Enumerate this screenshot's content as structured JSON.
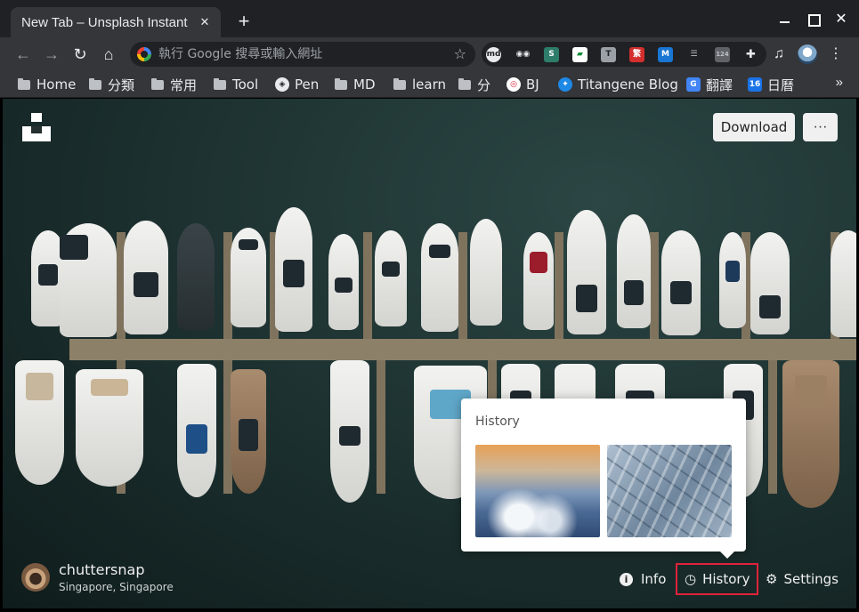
{
  "browser": {
    "tab_title": "New Tab – Unsplash Instant",
    "tab_close": "✕",
    "new_tab": "+",
    "omnibox_placeholder": "執行 Google 搜尋或輸入網址",
    "bookmarks": [
      "Home",
      "分類",
      "常用",
      "Tool",
      "Pen",
      "MD",
      "learn",
      "分",
      "BJ",
      "Titangene Blog",
      "翻譯",
      "日曆"
    ],
    "bookmarks_more": "»"
  },
  "page": {
    "download_label": "Download",
    "more_label": "···",
    "history_popup_title": "History",
    "photographer_name": "chuttersnap",
    "photographer_location": "Singapore, Singapore",
    "footer": {
      "info_label": "Info",
      "history_label": "History",
      "settings_label": "Settings"
    }
  },
  "colors": {
    "highlight_border": "#e0223a",
    "chrome_dark": "#202124",
    "chrome_toolbar": "#35363a"
  }
}
